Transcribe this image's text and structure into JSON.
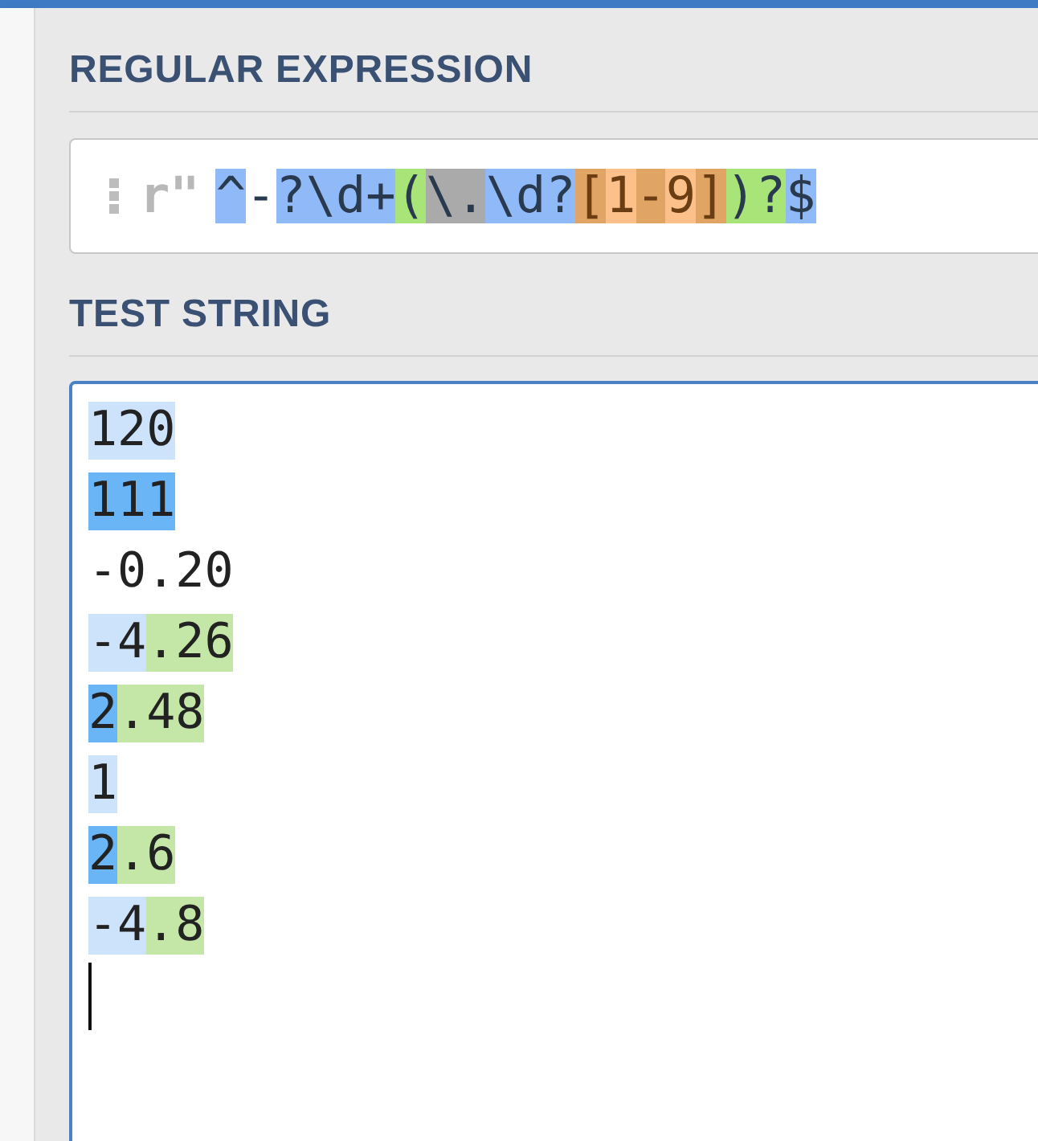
{
  "regex": {
    "heading": "REGULAR EXPRESSION",
    "prefix": "r\"",
    "tokens": [
      {
        "text": "^",
        "kind": "meta"
      },
      {
        "text": "-",
        "kind": "plain"
      },
      {
        "text": "?\\d+",
        "kind": "meta"
      },
      {
        "text": "(",
        "kind": "group"
      },
      {
        "text": "\\.",
        "kind": "escape"
      },
      {
        "text": "\\d?",
        "kind": "meta"
      },
      {
        "text": "[",
        "kind": "set"
      },
      {
        "text": "1",
        "kind": "set_char"
      },
      {
        "text": "-",
        "kind": "set"
      },
      {
        "text": "9",
        "kind": "set_char"
      },
      {
        "text": "]",
        "kind": "set"
      },
      {
        "text": ")?",
        "kind": "group"
      },
      {
        "text": "$",
        "kind": "meta"
      }
    ]
  },
  "test_string": {
    "heading": "TEST STRING",
    "lines": [
      {
        "segments": [
          {
            "text": "120",
            "kind": "match"
          }
        ]
      },
      {
        "segments": [
          {
            "text": "111",
            "kind": "match_alt"
          }
        ]
      },
      {
        "segments": [
          {
            "text": "-0.20",
            "kind": "none"
          }
        ]
      },
      {
        "segments": [
          {
            "text": "-4",
            "kind": "match"
          },
          {
            "text": ".26",
            "kind": "group"
          }
        ]
      },
      {
        "segments": [
          {
            "text": "2",
            "kind": "match_alt"
          },
          {
            "text": ".48",
            "kind": "group"
          }
        ]
      },
      {
        "segments": [
          {
            "text": "1",
            "kind": "match"
          }
        ]
      },
      {
        "segments": [
          {
            "text": "2",
            "kind": "match_alt"
          },
          {
            "text": ".6",
            "kind": "group"
          }
        ]
      },
      {
        "segments": [
          {
            "text": "-4",
            "kind": "match"
          },
          {
            "text": ".8",
            "kind": "group"
          }
        ]
      }
    ]
  }
}
